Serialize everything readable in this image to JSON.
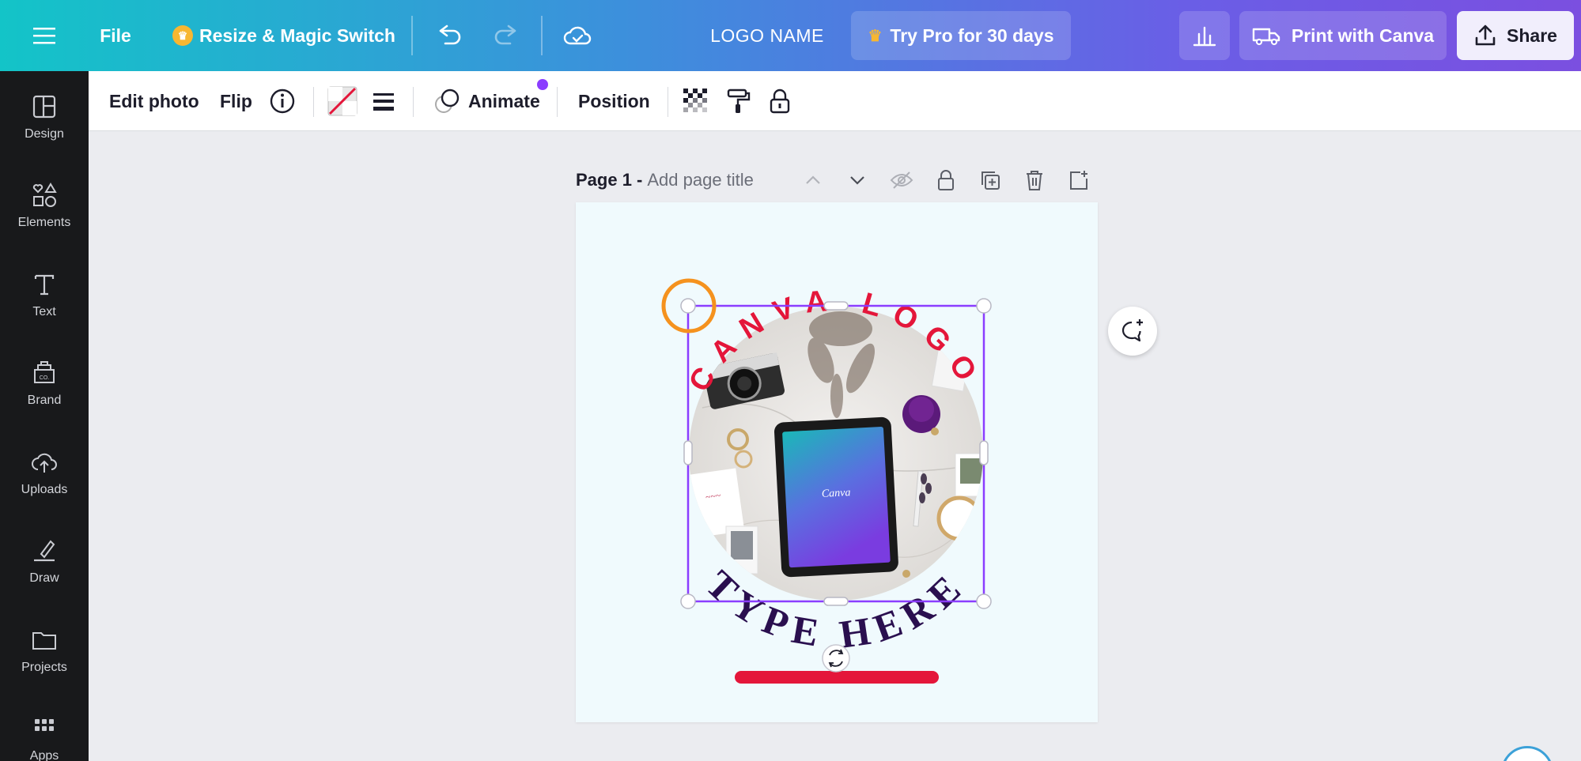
{
  "topbar": {
    "file_label": "File",
    "resize_label": "Resize & Magic Switch",
    "logo_name": "LOGO NAME",
    "try_pro_label": "Try Pro for 30 days",
    "print_label": "Print with Canva",
    "share_label": "Share"
  },
  "sidebar": {
    "items": [
      {
        "label": "Design",
        "icon": "layout-icon"
      },
      {
        "label": "Elements",
        "icon": "shapes-icon"
      },
      {
        "label": "Text",
        "icon": "text-icon"
      },
      {
        "label": "Brand",
        "icon": "brand-icon"
      },
      {
        "label": "Uploads",
        "icon": "upload-cloud-icon"
      },
      {
        "label": "Draw",
        "icon": "draw-icon"
      },
      {
        "label": "Projects",
        "icon": "folder-icon"
      },
      {
        "label": "Apps",
        "icon": "apps-grid-icon"
      }
    ]
  },
  "context_toolbar": {
    "edit_photo": "Edit photo",
    "flip": "Flip",
    "animate": "Animate",
    "position": "Position"
  },
  "page": {
    "title": "Page 1 -",
    "add_title_placeholder": "Add page title"
  },
  "design": {
    "top_text": "CANVA LOGO",
    "bottom_text": "TYPE HERE",
    "tablet_text": "Canva",
    "colors": {
      "accent_red": "#e4163a",
      "dark_purple": "#2a0f4f",
      "selection": "#8b3dff",
      "highlight_ring": "#f5921e"
    }
  }
}
